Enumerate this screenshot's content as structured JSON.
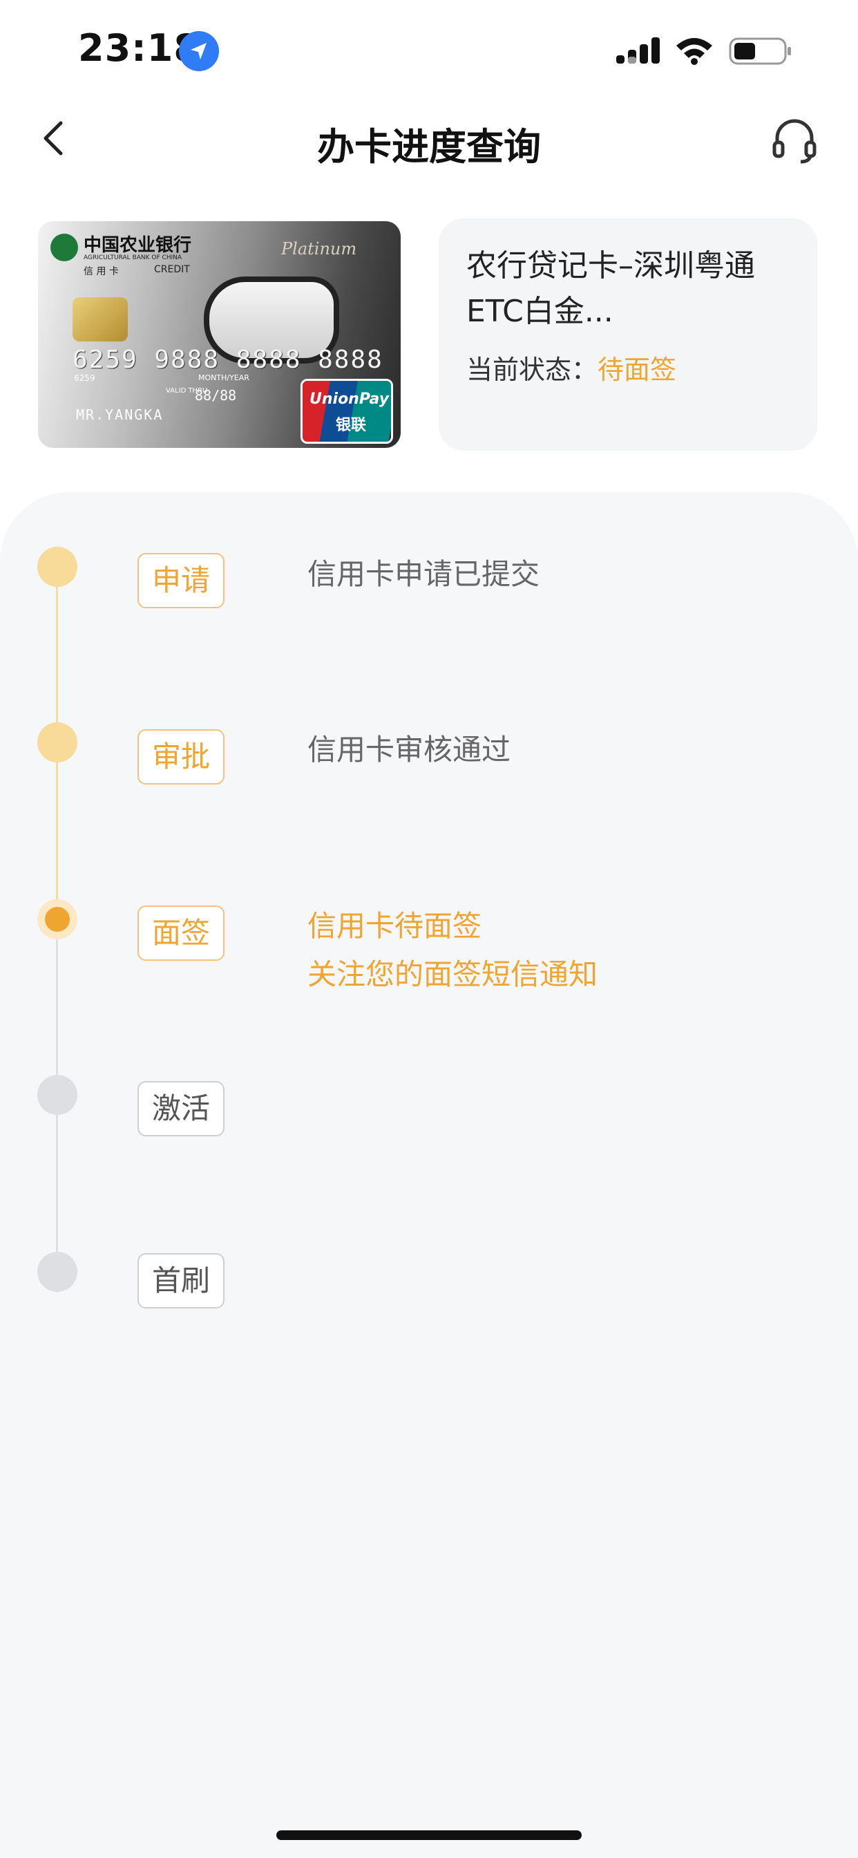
{
  "status_bar": {
    "time": "23:18"
  },
  "nav": {
    "title": "办卡进度查询"
  },
  "card": {
    "bank_name": "中国农业银行",
    "bank_name_en": "AGRICULTURAL BANK OF CHINA",
    "card_type": "信 用 卡",
    "credit": "CREDIT",
    "platinum": "Platinum",
    "number": "6259 9888 8888 8888",
    "number_small": "6259",
    "month_year": "MONTH/YEAR",
    "valid_thru": "VALID THRU",
    "expiry": "88/88",
    "holder": "MR.YANGKA",
    "union_pay": "UnionPay",
    "union_pay_cn": "银联"
  },
  "card_info": {
    "name": "农行贷记卡–深圳粤通ETC白金...",
    "status_label": "当前状态：",
    "status_value": "待面签",
    "status_color": "#f0a531"
  },
  "steps": [
    {
      "tag": "申请",
      "desc": [
        "信用卡申请已提交"
      ],
      "state": "done"
    },
    {
      "tag": "审批",
      "desc": [
        "信用卡审核通过"
      ],
      "state": "done"
    },
    {
      "tag": "面签",
      "desc": [
        "信用卡待面签",
        "关注您的面签短信通知"
      ],
      "state": "current"
    },
    {
      "tag": "激活",
      "desc": [],
      "state": "todo"
    },
    {
      "tag": "首刷",
      "desc": [],
      "state": "todo"
    }
  ],
  "colors": {
    "accent": "#f0a531",
    "done_dot": "#f8da99",
    "todo_dot": "#dedfe2",
    "panel_bg": "#f6f7f9"
  }
}
